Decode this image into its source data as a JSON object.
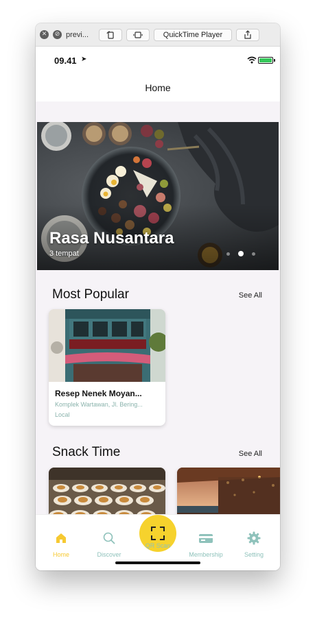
{
  "window": {
    "title": "previ...",
    "app_button_label": "QuickTime Player"
  },
  "status": {
    "time": "09.41",
    "battery_color": "#34c759"
  },
  "nav": {
    "title": "Home"
  },
  "hero": {
    "title": "Rasa Nusantara",
    "subtitle": "3 tempat",
    "pages": 3,
    "active_page": 2
  },
  "sections": {
    "most_popular": {
      "title": "Most Popular",
      "see_all": "See All",
      "cards": [
        {
          "title": "Resep Nenek Moyan...",
          "address": "Komplek Wartawan, Jl. Bering...",
          "tag": "Local"
        }
      ]
    },
    "snack_time": {
      "title": "Snack Time",
      "see_all": "See All"
    }
  },
  "tabbar": {
    "tabs": [
      {
        "label": "Home",
        "icon": "home-icon",
        "active": true
      },
      {
        "label": "Discover",
        "icon": "search-icon",
        "active": false
      },
      {
        "label": "QR Scan",
        "icon": "qr-scan-icon",
        "active": false
      },
      {
        "label": "Membership",
        "icon": "membership-card-icon",
        "active": false
      },
      {
        "label": "Setting",
        "icon": "gear-icon",
        "active": false
      }
    ]
  },
  "colors": {
    "accent": "#f6d22d",
    "active_tab": "#f6c932",
    "inactive_tab": "#8fc2bb",
    "card_subtext": "#8ab3ac"
  }
}
